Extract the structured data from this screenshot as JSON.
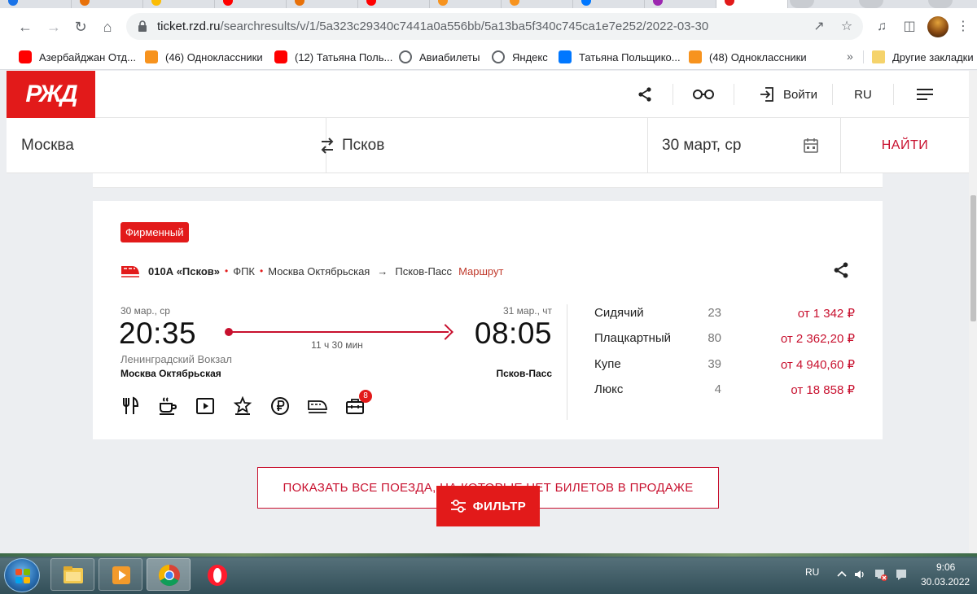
{
  "browser": {
    "url_host": "ticket.rzd.ru",
    "url_path": "/searchresults/v/1/5a323c29340c7441a0a556bb/5a13ba5f340c745ca1e7e252/2022-03-30",
    "bookmarks": [
      {
        "label": "Азербайджан Отд...",
        "icon": "youtube-icon"
      },
      {
        "label": "(46) Одноклассники",
        "icon": "ok-icon"
      },
      {
        "label": "(12) Татьяна Поль...",
        "icon": "youtube-icon"
      },
      {
        "label": "Авиабилеты",
        "icon": "globe-icon"
      },
      {
        "label": "Яндекс",
        "icon": "globe-icon"
      },
      {
        "label": "Татьяна Польщико...",
        "icon": "vk-icon"
      },
      {
        "label": "(48) Одноклассники",
        "icon": "ok-icon"
      }
    ],
    "more_bookmarks": "»",
    "other_bookmarks": "Другие закладки"
  },
  "header": {
    "logo": "РЖД",
    "login_label": "Войти",
    "language": "RU"
  },
  "search": {
    "from": "Москва",
    "to": "Псков",
    "date": "30 март, ср",
    "find_label": "НАЙТИ"
  },
  "train": {
    "badge": "Фирменный",
    "number": "010А «Псков»",
    "carrier": "ФПК",
    "route_from": "Москва Октябрьская",
    "route_arrow": "→",
    "route_to": "Псков-Пасс",
    "route_link": "Маршрут",
    "departure_date": "30 мар., ср",
    "arrival_date": "31 мар., чт",
    "departure_time": "20:35",
    "arrival_time": "08:05",
    "duration": "11 ч 30 мин",
    "departure_vokzal": "Ленинградский Вокзал",
    "departure_station": "Москва Октябрьская",
    "arrival_station": "Псков-Пасс",
    "services": [
      "restaurant-icon",
      "coffee-icon",
      "video-icon",
      "star-icon",
      "ruble-icon",
      "train-icon",
      "luggage-icon"
    ],
    "luggage_count": "8",
    "classes": [
      {
        "name": "Сидячий",
        "seats": "23",
        "price": "от 1 342 ₽"
      },
      {
        "name": "Плацкартный",
        "seats": "80",
        "price": "от 2 362,20 ₽"
      },
      {
        "name": "Купе",
        "seats": "39",
        "price": "от 4 940,60 ₽"
      },
      {
        "name": "Люкс",
        "seats": "4",
        "price": "от 18 858 ₽"
      }
    ]
  },
  "actions": {
    "show_all_label": "ПОКАЗАТЬ ВСЕ ПОЕЗДА, НА КОТОРЫЕ НЕТ БИЛЕТОВ В ПРОДАЖЕ",
    "filter_label": "ФИЛЬТР"
  },
  "taskbar": {
    "language": "RU",
    "time": "9:06",
    "date": "30.03.2022"
  },
  "colors": {
    "brand_red": "#e21a1a",
    "price_red": "#c8102e"
  }
}
